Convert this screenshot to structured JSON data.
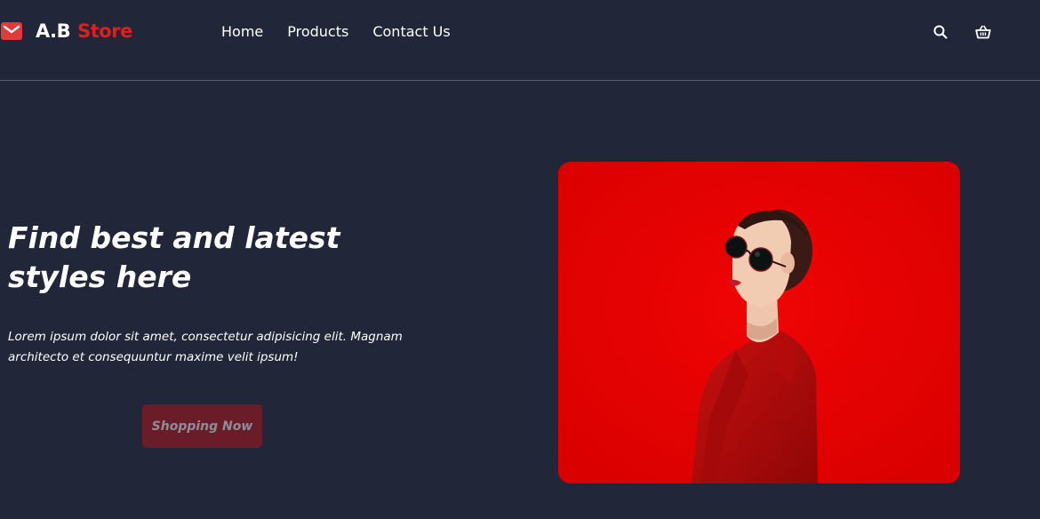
{
  "brand": {
    "main": "A.B",
    "accent": "Store",
    "icon": "envelope-icon"
  },
  "nav": {
    "items": [
      "Home",
      "Products",
      "Contact Us"
    ]
  },
  "header_icons": [
    "search-icon",
    "basket-icon"
  ],
  "hero": {
    "title": "Find best and latest styles here",
    "description": "Lorem ipsum dolor sit amet, consectetur adipisicing elit. Magnam architecto et consequuntur maxime velit ipsum!",
    "cta_label": "Shopping Now",
    "image": "woman-in-red-with-sunglasses"
  },
  "colors": {
    "background": "#212738",
    "accent": "#e01e1e",
    "cta_background": "#6b1c29",
    "image_background": "#e60000"
  }
}
